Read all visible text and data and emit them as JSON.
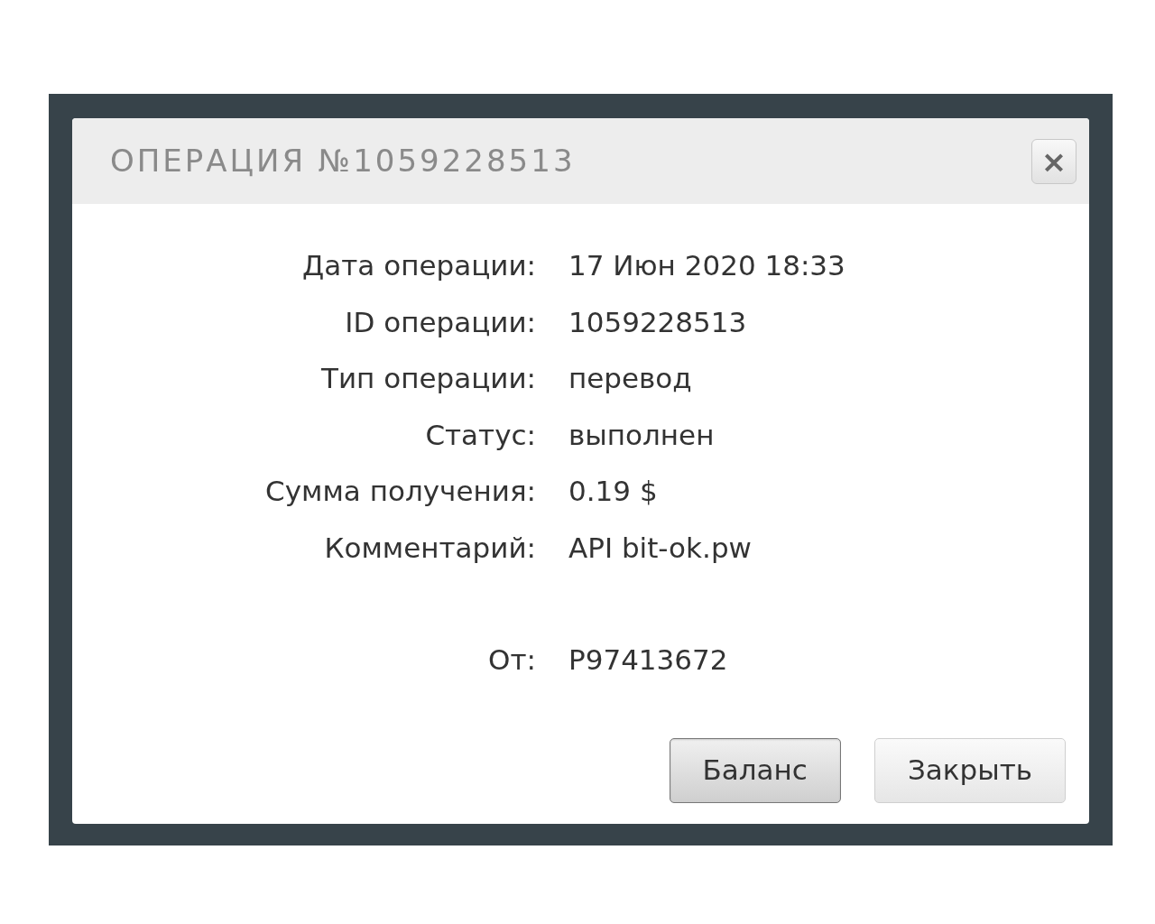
{
  "dialog": {
    "title": "ОПЕРАЦИЯ №1059228513",
    "close_symbol": "×",
    "fields": [
      {
        "label": "Дата операции:",
        "value": "17 Июн 2020 18:33"
      },
      {
        "label": "ID операции:",
        "value": "1059228513"
      },
      {
        "label": "Тип операции:",
        "value": "перевод"
      },
      {
        "label": "Статус:",
        "value": "выполнен"
      },
      {
        "label": "Сумма получения:",
        "value": "0.19 $"
      },
      {
        "label": "Комментарий:",
        "value": "API bit-ok.pw"
      }
    ],
    "sender": {
      "label": "От:",
      "value": "P97413672"
    },
    "buttons": [
      {
        "label": "Баланс",
        "focused": true
      },
      {
        "label": "Закрыть",
        "focused": false
      }
    ]
  }
}
